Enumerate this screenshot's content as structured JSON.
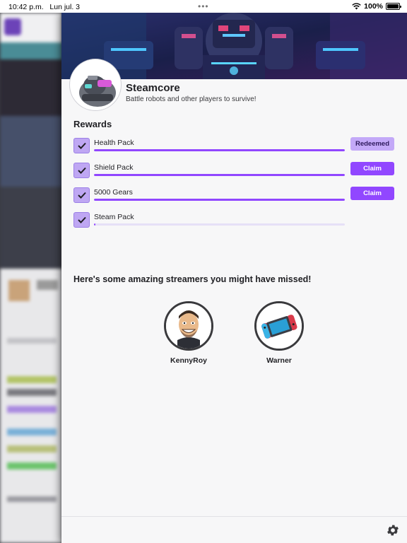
{
  "status_bar": {
    "time": "10:42 p.m.",
    "date": "Lun jul. 3",
    "battery": "100%"
  },
  "game": {
    "title": "Steamcore",
    "subtitle": "Battle robots and other players to survive!"
  },
  "rewards": {
    "heading": "Rewards",
    "items": [
      {
        "name": "Health Pack",
        "progress": 1.0,
        "checked": true,
        "button": "Redeemed",
        "state": "redeemed"
      },
      {
        "name": "Shield Pack",
        "progress": 1.0,
        "checked": true,
        "button": "Claim",
        "state": "claim"
      },
      {
        "name": "5000 Gears",
        "progress": 1.0,
        "checked": true,
        "button": "Claim",
        "state": "claim"
      },
      {
        "name": "Steam Pack",
        "progress": 0.0,
        "checked": true,
        "button": "",
        "state": "none"
      }
    ]
  },
  "streamers": {
    "heading": "Here's some amazing streamers you might have missed!",
    "items": [
      {
        "name": "KennyRoy",
        "avatar_icon": "cartoon-face-icon"
      },
      {
        "name": "Warner",
        "avatar_icon": "handheld-console-icon"
      }
    ]
  },
  "footer": {
    "settings_icon": "gear-icon"
  },
  "colors": {
    "accent": "#9147ff",
    "accent_light": "#c3a9f8",
    "check_bg": "#bfa7f3",
    "panel_bg": "#f7f7f8"
  }
}
